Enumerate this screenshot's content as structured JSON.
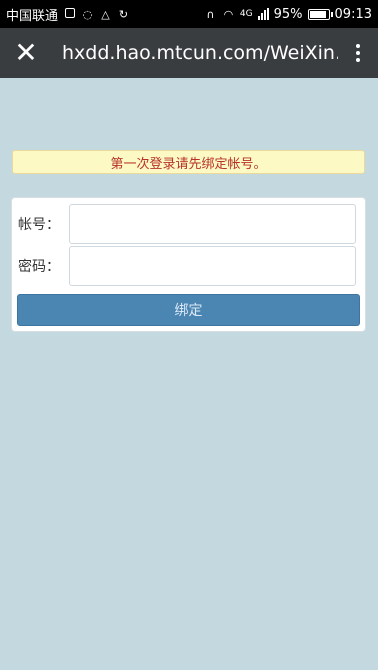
{
  "status_bar": {
    "carrier": "中国联通",
    "battery_percent": "95%",
    "battery_level": 0.95,
    "time": "09:13",
    "network": "4G",
    "icons": [
      "image-icon",
      "sync-icon",
      "cleaner-icon",
      "refresh-icon",
      "headphones-icon",
      "wifi-icon",
      "signal-icon",
      "battery-icon"
    ]
  },
  "app_bar": {
    "close_icon": "close-icon",
    "url": "hxdd.hao.mtcun.com/WeiXin…",
    "menu_icon": "more-vertical-icon"
  },
  "notice": {
    "text": "第一次登录请先绑定帐号。",
    "color": "#b8322a"
  },
  "form": {
    "account_label": "帐号：",
    "account_value": "",
    "password_label": "密码：",
    "password_value": "",
    "bind_button": "绑定"
  },
  "colors": {
    "background": "#c3d9df",
    "appbar": "#3a3d40",
    "button": "#4b86b3",
    "notice_bg": "#fcf9c4"
  }
}
